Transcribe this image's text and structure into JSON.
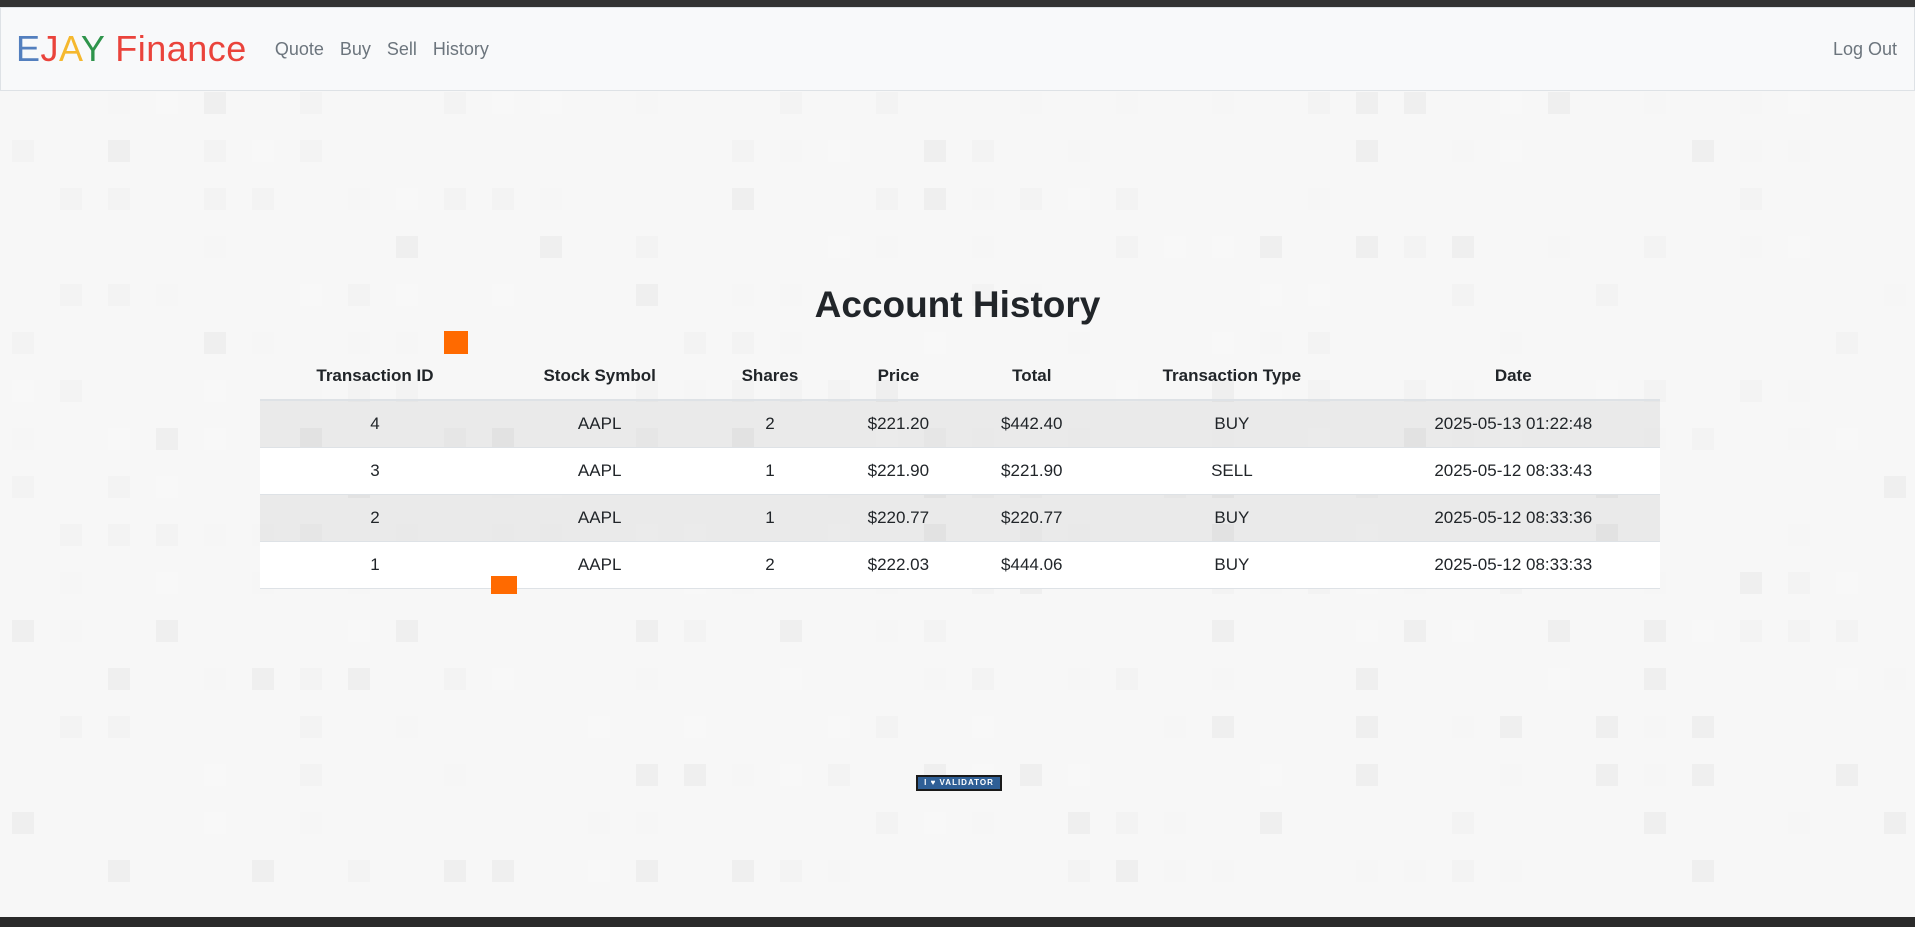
{
  "brand": {
    "parts": [
      "E",
      "J",
      "A",
      "Y",
      " Finance"
    ],
    "colors": [
      "#537fbe",
      "#ea433b",
      "#f5b82e",
      "#2e944b",
      "#ea433b"
    ]
  },
  "nav": {
    "links": [
      "Quote",
      "Buy",
      "Sell",
      "History"
    ],
    "logout": "Log Out"
  },
  "page": {
    "title": "Account History"
  },
  "table": {
    "headers": [
      "Transaction ID",
      "Stock Symbol",
      "Shares",
      "Price",
      "Total",
      "Transaction Type",
      "Date"
    ],
    "rows": [
      [
        "4",
        "AAPL",
        "2",
        "$221.20",
        "$442.40",
        "BUY",
        "2025-05-13 01:22:48"
      ],
      [
        "3",
        "AAPL",
        "1",
        "$221.90",
        "$221.90",
        "SELL",
        "2025-05-12 08:33:43"
      ],
      [
        "2",
        "AAPL",
        "1",
        "$220.77",
        "$220.77",
        "BUY",
        "2025-05-12 08:33:36"
      ],
      [
        "1",
        "AAPL",
        "2",
        "$222.03",
        "$444.06",
        "BUY",
        "2025-05-12 08:33:33"
      ]
    ]
  },
  "footer": {
    "validator_label": "I ♥ VALIDATOR"
  },
  "colors": {
    "accent_orange": "#ff6a00",
    "navbar_bg": "#f8f9fa"
  }
}
